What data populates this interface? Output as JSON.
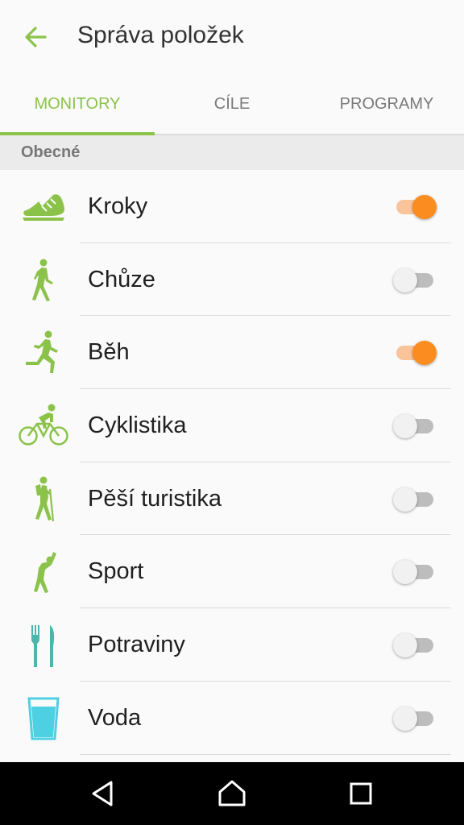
{
  "header": {
    "title": "Správa položek",
    "back_icon": "arrow-left-icon"
  },
  "tabs": [
    {
      "label": "MONITORY",
      "active": true
    },
    {
      "label": "CÍLE",
      "active": false
    },
    {
      "label": "PROGRAMY",
      "active": false
    }
  ],
  "section": {
    "title": "Obecné"
  },
  "items": [
    {
      "label": "Kroky",
      "icon": "shoe-icon",
      "enabled": true
    },
    {
      "label": "Chůze",
      "icon": "walking-icon",
      "enabled": false
    },
    {
      "label": "Běh",
      "icon": "running-icon",
      "enabled": true
    },
    {
      "label": "Cyklistika",
      "icon": "cycling-icon",
      "enabled": false
    },
    {
      "label": "Pěší turistika",
      "icon": "hiking-icon",
      "enabled": false
    },
    {
      "label": "Sport",
      "icon": "stretching-icon",
      "enabled": false
    },
    {
      "label": "Potraviny",
      "icon": "fork-knife-icon",
      "enabled": false
    },
    {
      "label": "Voda",
      "icon": "water-glass-icon",
      "enabled": false
    }
  ],
  "colors": {
    "accent": "#8bc34a",
    "toggle_on": "#fb8c1f",
    "food_icon": "#4db6ac",
    "water_icon": "#4dd0e1"
  },
  "navbar": {
    "buttons": [
      "back-triangle-icon",
      "home-icon",
      "recents-square-icon"
    ]
  }
}
